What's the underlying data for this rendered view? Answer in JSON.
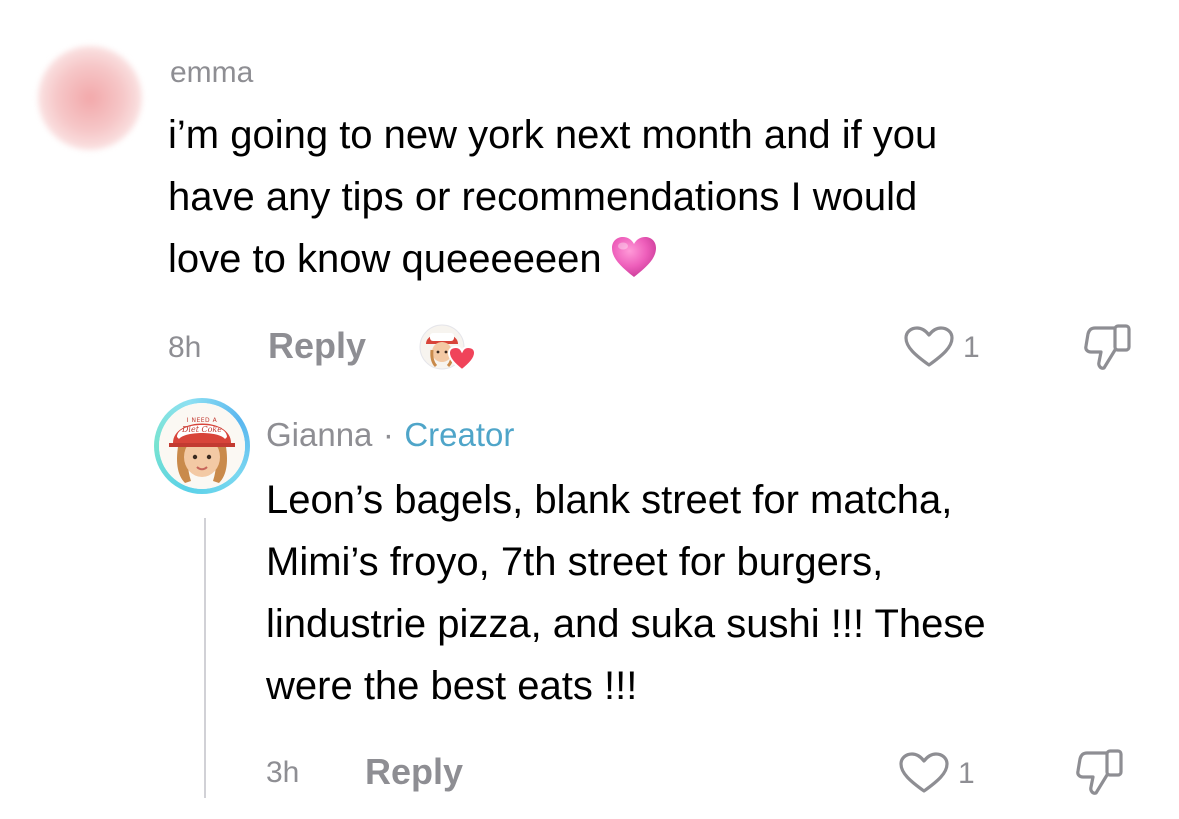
{
  "comment": {
    "username": "emma",
    "text": "i’m going to new york next month and if you\nhave any tips or recommendations I would\nlove to know queeeeeen",
    "emoji": "pink-heart-emoji",
    "time": "8h",
    "reply_label": "Reply",
    "likes": "1",
    "liked_by_creator": true
  },
  "reply": {
    "username": "Gianna",
    "separator": "·",
    "badge": "Creator",
    "avatar_caption_top": "I NEED A",
    "avatar_caption_bottom": "Diet Coke",
    "text": "Leon’s bagels, blank street for matcha,\nMimi’s froyo, 7th street for burgers,\nlindustrie pizza, and suka sushi !!! These\nwere the best eats !!!",
    "time": "3h",
    "reply_label": "Reply",
    "likes": "1"
  },
  "colors": {
    "meta_gray": "#8e8e93",
    "creator_blue": "#4fa5c9",
    "heart_red": "#f0435a",
    "emoji_pink": "#ee5fbb"
  }
}
